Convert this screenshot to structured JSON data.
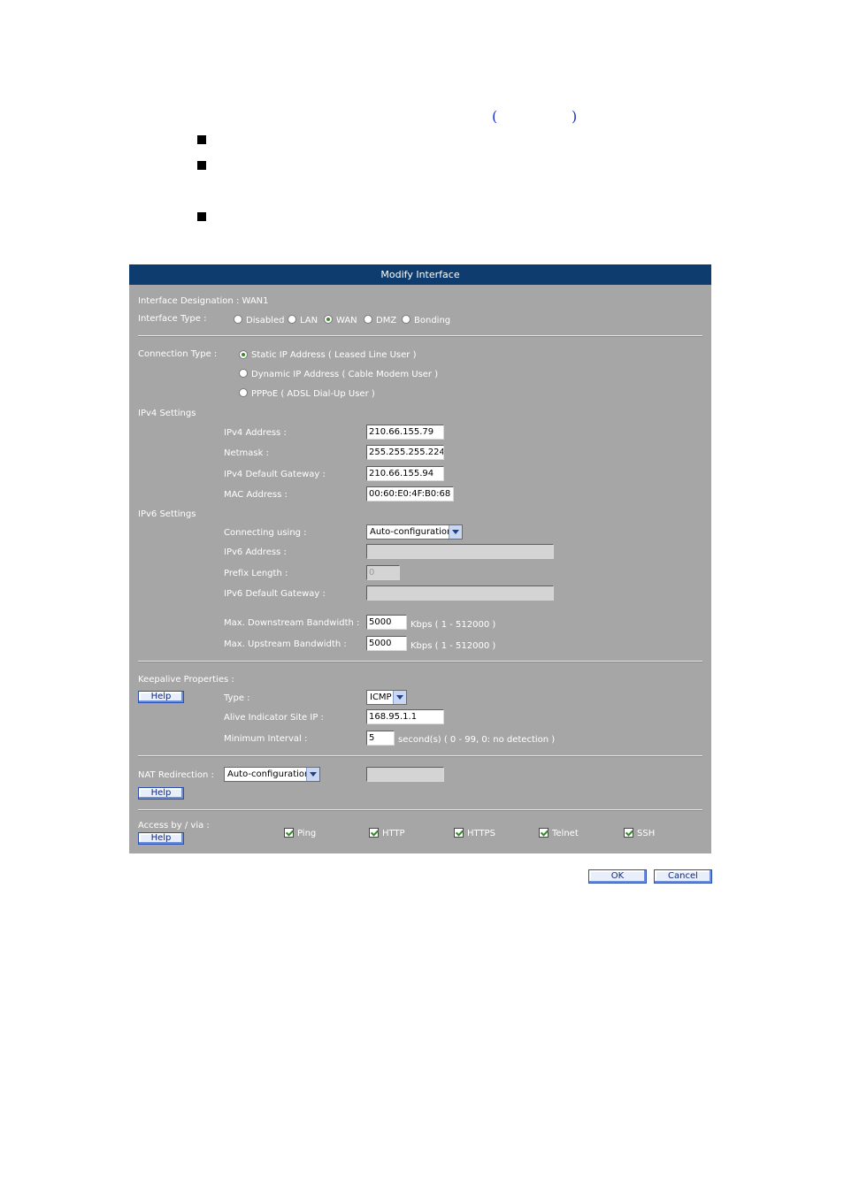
{
  "doc": {
    "paren_open": "(",
    "paren_close": ")"
  },
  "panel": {
    "title": "Modify Interface",
    "interface_designation": "Interface Designation : WAN1",
    "interface_type_label": "Interface Type :",
    "interface_types": [
      "Disabled",
      "LAN",
      "WAN",
      "DMZ",
      "Bonding"
    ],
    "interface_type_selected": "WAN",
    "connection_type_label": "Connection Type :",
    "connection_types": [
      "Static IP Address ( Leased Line User )",
      "Dynamic IP Address ( Cable Modem User )",
      "PPPoE ( ADSL Dial-Up User )"
    ],
    "connection_type_selected": "Static IP Address ( Leased Line User )",
    "ipv4": {
      "section": "IPv4 Settings",
      "address_label": "IPv4 Address :",
      "address": "210.66.155.79",
      "netmask_label": "Netmask :",
      "netmask": "255.255.255.224",
      "gateway_label": "IPv4 Default Gateway :",
      "gateway": "210.66.155.94",
      "mac_label": "MAC Address :",
      "mac": "00:60:E0:4F:B0:68"
    },
    "ipv6": {
      "section": "IPv6 Settings",
      "connecting_label": "Connecting using :",
      "connecting_value": "Auto-configuration",
      "address_label": "IPv6 Address :",
      "address": "",
      "prefix_label": "Prefix Length :",
      "prefix": "0",
      "gateway_label": "IPv6 Default Gateway :",
      "gateway": ""
    },
    "bandwidth": {
      "down_label": "Max. Downstream Bandwidth :",
      "down_value": "5000",
      "down_unit": "Kbps ( 1 - 512000 )",
      "up_label": "Max. Upstream Bandwidth :",
      "up_value": "5000",
      "up_unit": "Kbps ( 1 - 512000 )"
    },
    "keepalive": {
      "section": "Keepalive Properties :",
      "help": "Help",
      "type_label": "Type :",
      "type_value": "ICMP",
      "site_label": "Alive Indicator Site IP :",
      "site_value": "168.95.1.1",
      "interval_label": "Minimum Interval :",
      "interval_value": "5",
      "interval_hint": "second(s)  ( 0 - 99, 0: no detection )"
    },
    "nat": {
      "label": "NAT Redirection :",
      "value": "Auto-configuration",
      "help": "Help",
      "extra": ""
    },
    "access": {
      "label": "Access by / via :",
      "help": "Help",
      "options": [
        "Ping",
        "HTTP",
        "HTTPS",
        "Telnet",
        "SSH"
      ],
      "checked": [
        true,
        true,
        true,
        true,
        true
      ]
    }
  },
  "buttons": {
    "ok": "OK",
    "cancel": "Cancel"
  },
  "colors": {
    "title_bar": "#0f3c6e",
    "panel_bg": "#a6a6a6",
    "link": "#1a33cc"
  }
}
